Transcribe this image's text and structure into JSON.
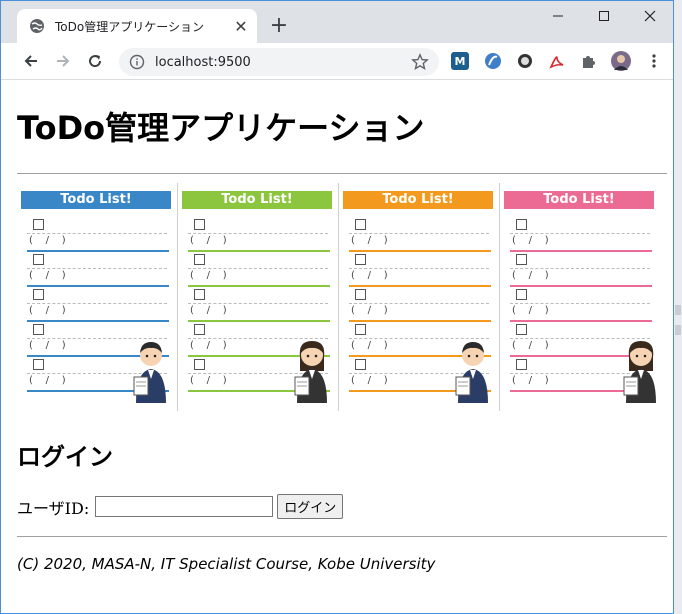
{
  "browser": {
    "tab_title": "ToDo管理アプリケーション",
    "url": "localhost:9500"
  },
  "page": {
    "heading": "ToDo管理アプリケーション",
    "banner": {
      "panel_title": "Todo List!",
      "date_placeholder": "(    /    )",
      "colors": [
        "#3a87c8",
        "#8cc63f",
        "#f39a1e",
        "#ec6b95"
      ]
    },
    "login": {
      "heading": "ログイン",
      "user_id_label": "ユーザID:",
      "user_id_value": "",
      "submit_label": "ログイン"
    },
    "footer": "(C) 2020, MASA-N, IT Specialist Course, Kobe University"
  }
}
